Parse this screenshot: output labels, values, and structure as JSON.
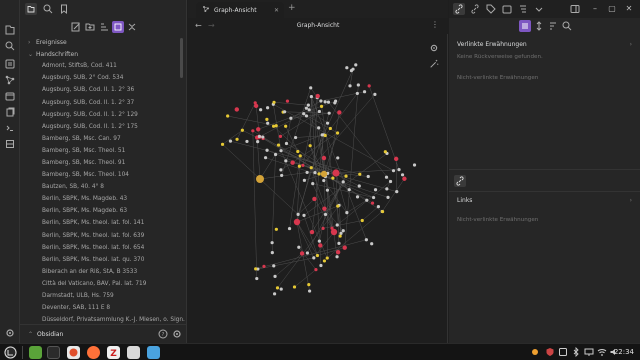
{
  "colors": {
    "accent": "#7e57c2",
    "node_default": "#c9c9c9",
    "node_yellow": "#e6c934",
    "node_red": "#d7374e",
    "node_large": "#d4a338",
    "edge": "#4e4e4e"
  },
  "ribbon": {
    "icons": [
      "files-icon",
      "search-icon",
      "bookmark-icon",
      "graph-icon",
      "calendar-icon",
      "copy-icon",
      "terminal-icon",
      "help-icon"
    ]
  },
  "left": {
    "folders": [
      {
        "name": "Ereignisse",
        "expanded": false
      },
      {
        "name": "Handschriften",
        "expanded": true
      }
    ],
    "files": [
      "Admont, StiftsB, Cod. 411",
      "Augsburg, SUB, 2° Cod. 534",
      "Augsburg, SUB, Cod. II. 1. 2° 36",
      "Augsburg, SUB, Cod. II. 1. 2° 37",
      "Augsburg, SUB, Cod. II. 1. 2° 129",
      "Augsburg, SUB, Cod. II. 1. 2° 175",
      "Bamberg, SB, Msc. Can. 97",
      "Bamberg, SB, Msc. Theol. 51",
      "Bamberg, SB, Msc. Theol. 91",
      "Bamberg, SB, Msc. Theol. 104",
      "Bautzen, SB, 40. 4° 8",
      "Berlin, SBPK, Ms. Magdeb. 43",
      "Berlin, SBPK, Ms. Magdeb. 63",
      "Berlin, SBPK, Ms. theol. lat. fol. 141",
      "Berlin, SBPK, Ms. theol. lat. fol. 639",
      "Berlin, SBPK, Ms. theol. lat. fol. 654",
      "Berlin, SBPK, Ms. theol. lat. qu. 370",
      "Biberach an der Riß, StA, B 3533",
      "Città del Vaticano, BAV, Pal. lat. 719",
      "Darmstadt, ULB, Hs. 759",
      "Deventer, SAB, 111 E 8",
      "Düsseldorf, Privatsammlung K.-J. Miesen, o. Sign."
    ],
    "vault_name": "Obsidian"
  },
  "center": {
    "tab_title": "Graph-Ansicht",
    "view_title": "Graph-Ansicht"
  },
  "right": {
    "linked_header": "Verlinkte Erwähnungen",
    "linked_none": "Keine Rückverweise gefunden.",
    "unlinked_header": "Nicht-verlinkte Erwähnungen",
    "links_header": "Links",
    "links_unlinked": "Nicht-verlinkte Erwähnungen"
  },
  "taskbar": {
    "clock": "22:34",
    "apps": [
      "system-menu-icon",
      "files-app-icon",
      "terminal-app-icon",
      "browser-app-icon",
      "firefox-app-icon",
      "zotero-app-icon",
      "text-editor-app-icon",
      "obsidian-app-icon"
    ]
  }
}
